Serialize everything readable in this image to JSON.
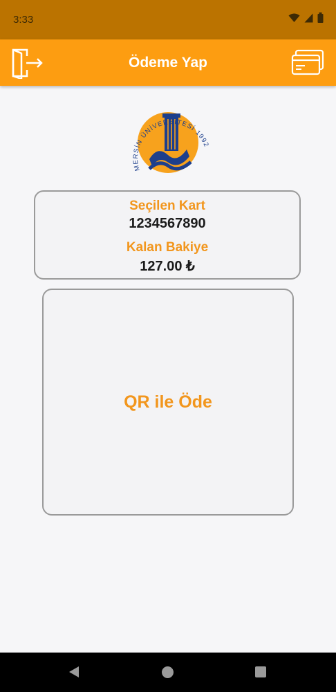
{
  "status_bar": {
    "time": "3:33"
  },
  "app_bar": {
    "title": "Ödeme Yap",
    "background": "#fd9d11",
    "logout_icon": "logout-icon",
    "card_icon": "credit-card-icon"
  },
  "logo": {
    "name": "mersin-university-logo",
    "text": "MERSİN ÜNİVERSİTESİ 1992"
  },
  "card_info": {
    "selected_label": "Seçilen Kart",
    "selected_value": "1234567890",
    "balance_label": "Kalan Bakiye",
    "balance_value": "127.00 ₺"
  },
  "qr": {
    "label": "QR ile Öde"
  },
  "accent_color": "#f2961d"
}
